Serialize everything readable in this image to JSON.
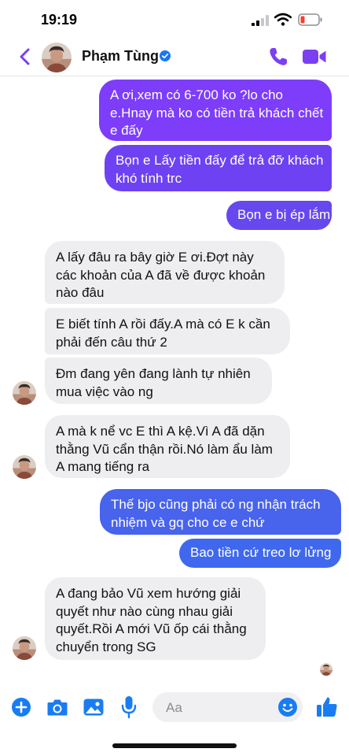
{
  "status": {
    "time": "19:19"
  },
  "header": {
    "name": "Phạm Tùng"
  },
  "messages": [
    {
      "dir": "out",
      "lines": [
        "A ơi,xem có 6-700 ko ?lo cho",
        "e.Hnay mà ko có tiền trả khách chết",
        "e đấy"
      ]
    },
    {
      "dir": "out",
      "lines": [
        "Bọn e Lấy tiền đấy để trả đỡ khách",
        "khó tính trc"
      ]
    },
    {
      "dir": "out",
      "lines": [
        "Bọn e bị ép lắm"
      ]
    },
    {
      "dir": "in",
      "lines": [
        "A lấy đâu ra bây giờ E ơi.Đợt này",
        "các khoản của A đã về được khoản",
        "nào đâu"
      ]
    },
    {
      "dir": "in",
      "lines": [
        "E biết tính A rồi đấy.A mà có E k cần",
        "phải đến câu thứ 2"
      ]
    },
    {
      "dir": "in",
      "lines": [
        "Đm đang yên đang lành tự nhiên",
        "mua việc vào ng"
      ]
    },
    {
      "dir": "in",
      "lines": [
        "A mà k nể vc E thì A kệ.Vì A đã dặn",
        "thằng Vũ cẩn thận rồi.Nó làm ẩu làm",
        "A mang tiếng ra"
      ]
    },
    {
      "dir": "out",
      "lines": [
        "Thế bjo cũng phải có ng nhận trách",
        "nhiệm và gq cho ce e chứ"
      ]
    },
    {
      "dir": "out",
      "lines": [
        "Bao tiền cứ treo lơ lửng"
      ]
    },
    {
      "dir": "in",
      "lines": [
        "A đang bảo Vũ xem hướng giải",
        "quyết như nào cùng nhau giải",
        "quyết.Rồi A mới Vũ ốp cái thằng",
        "chuyển trong SG"
      ]
    }
  ],
  "composer": {
    "placeholder": "Aa"
  },
  "icons": {
    "back": "chevron-left-icon",
    "verified": "verified-badge-icon",
    "call": "phone-icon",
    "video": "video-camera-icon",
    "plus": "plus-circle-icon",
    "camera": "camera-icon",
    "image": "image-icon",
    "mic": "microphone-icon",
    "emoji": "emoji-icon",
    "like": "thumbs-up-icon"
  },
  "colors": {
    "accent": "#7b3ff2",
    "composer_blue": "#1a7cf2",
    "incoming_bubble": "#eeeef0"
  }
}
